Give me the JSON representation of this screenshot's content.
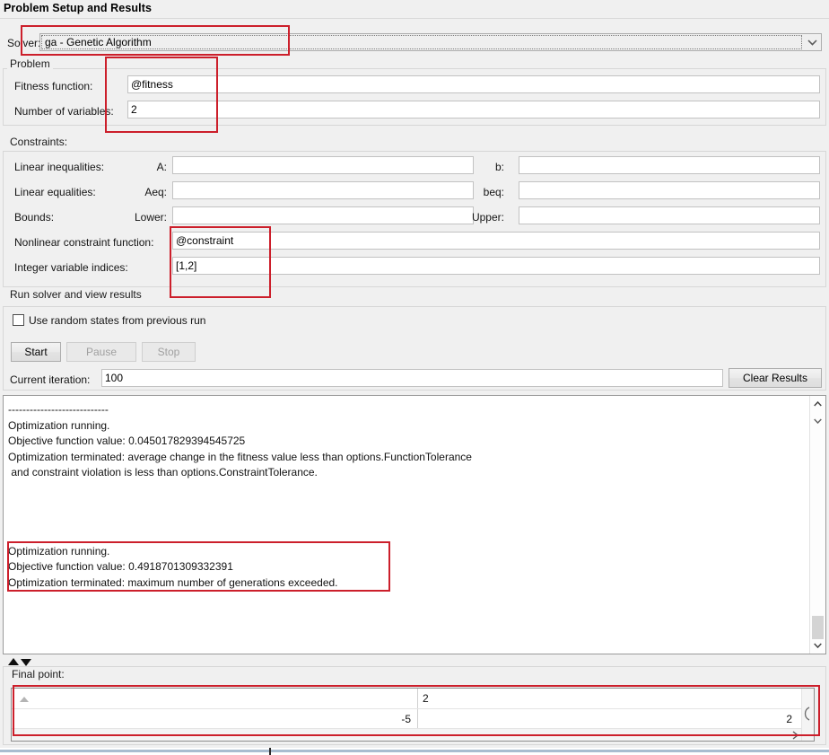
{
  "window": {
    "title": "Problem Setup and Results"
  },
  "solver": {
    "label": "Solver:",
    "value": "ga - Genetic Algorithm",
    "arrow_icon": "chevron-down-icon"
  },
  "problem": {
    "group_label": "Problem",
    "fitness_function": {
      "label": "Fitness function:",
      "value": "@fitness"
    },
    "number_of_variables": {
      "label": "Number of variables:",
      "value": "2"
    }
  },
  "constraints": {
    "group_label": "Constraints:",
    "linear_inequalities": {
      "label": "Linear inequalities:",
      "a_label": "A:",
      "a_value": "",
      "b_label": "b:",
      "b_value": ""
    },
    "linear_equalities": {
      "label": "Linear equalities:",
      "aeq_label": "Aeq:",
      "aeq_value": "",
      "beq_label": "beq:",
      "beq_value": ""
    },
    "bounds": {
      "label": "Bounds:",
      "lower_label": "Lower:",
      "lower_value": "",
      "upper_label": "Upper:",
      "upper_value": ""
    },
    "nonlinear_constraint_function": {
      "label": "Nonlinear constraint function:",
      "value": "@constraint"
    },
    "integer_variable_indices": {
      "label": "Integer variable indices:",
      "value": "[1,2]"
    }
  },
  "run_solver": {
    "group_label": "Run solver and view results",
    "use_random_states": {
      "label": "Use random states from previous run",
      "checked": false
    },
    "start_button": "Start",
    "pause_button": "Pause",
    "stop_button": "Stop",
    "current_iteration_label": "Current iteration:",
    "current_iteration_value": "100",
    "clear_results_button": "Clear Results"
  },
  "results": {
    "text": "----------------------------\nOptimization running.\nObjective function value: 0.045017829394545725\nOptimization terminated: average change in the fitness value less than options.FunctionTolerance\n and constraint violation is less than options.ConstraintTolerance.\n\n\n\n\nOptimization running.\nObjective function value: 0.4918701309332391\nOptimization terminated: maximum number of generations exceeded.",
    "scroll_up_icon": "chevron-up-icon",
    "scroll_down_icon": "chevron-down-icon"
  },
  "final_point": {
    "group_label": "Final point:",
    "rows": [
      {
        "col1": "",
        "col2": "2",
        "col3": ""
      },
      {
        "col1": "-5",
        "col2": "",
        "col3": "2"
      }
    ],
    "sort_icon": "sort-ascending-icon",
    "hscroll_right_icon": "chevron-right-icon",
    "vscroll_icon": "scroll-thumb-icon"
  },
  "splitter": {
    "up_icon": "triangle-up-icon",
    "down_icon": "triangle-down-icon"
  },
  "colors": {
    "annotation": "#cc1f2b",
    "panel_bg": "#f0f0f0",
    "field_bg": "#ffffff",
    "border": "#c2c2c2"
  }
}
